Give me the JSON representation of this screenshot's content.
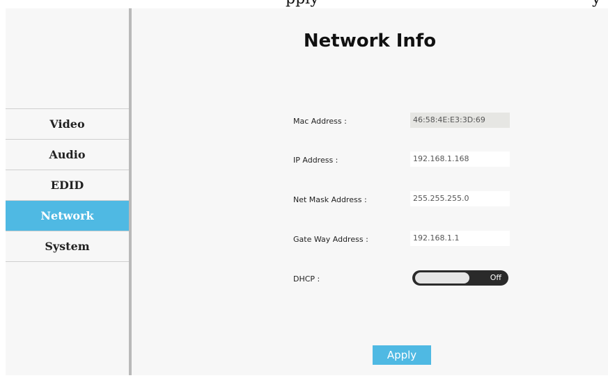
{
  "top_fragment": {
    "left_text": "pply",
    "right_text": "y"
  },
  "sidebar": {
    "items": [
      {
        "label": "Video",
        "active": false
      },
      {
        "label": "Audio",
        "active": false
      },
      {
        "label": "EDID",
        "active": false
      },
      {
        "label": "Network",
        "active": true
      },
      {
        "label": "System",
        "active": false
      }
    ]
  },
  "main": {
    "title": "Network Info",
    "mac": {
      "label": "Mac Address :",
      "value": "46:58:4E:E3:3D:69"
    },
    "ip": {
      "label": "IP Address :",
      "value": "192.168.1.168"
    },
    "netmask": {
      "label": "Net Mask Address :",
      "value": "255.255.255.0"
    },
    "gateway": {
      "label": "Gate Way Address :",
      "value": "192.168.1.1"
    },
    "dhcp": {
      "label": "DHCP :",
      "state": "Off"
    },
    "apply_label": "Apply"
  },
  "colors": {
    "accent": "#4fb9e3",
    "panel_bg": "#f7f7f7",
    "divider": "#b9b9b9",
    "toggle_bg": "#2a2a2a"
  }
}
